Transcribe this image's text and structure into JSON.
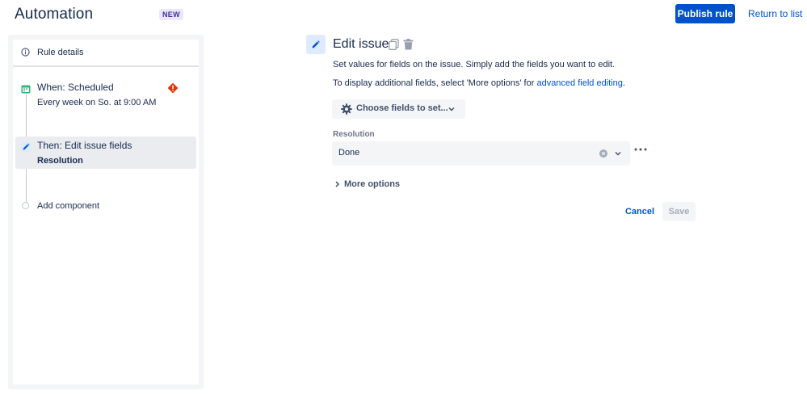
{
  "header": {
    "title": "Automation",
    "badge": "NEW",
    "publish_label": "Publish rule",
    "return_label": "Return to list"
  },
  "sidebar": {
    "rule_details_label": "Rule details",
    "trigger": {
      "title": "When: Scheduled",
      "subtitle": "Every week on So. at 9:00 AM",
      "icon": "calendar-icon",
      "has_error": true
    },
    "action": {
      "title": "Then: Edit issue fields",
      "subtitle": "Resolution",
      "icon": "pencil-icon",
      "selected": true
    },
    "add_component_label": "Add component"
  },
  "editor": {
    "title": "Edit issue",
    "description": "Set values for fields on the issue. Simply add the fields you want to edit.",
    "description2_prefix": "To display additional fields, select 'More options' for ",
    "description2_link": "advanced field editing",
    "description2_suffix": ".",
    "choose_fields_label": "Choose fields to set...",
    "field": {
      "label": "Resolution",
      "value": "Done"
    },
    "more_options_label": "More options",
    "cancel_label": "Cancel",
    "save_label": "Save"
  },
  "colors": {
    "primary": "#0052CC",
    "text": "#172B4D",
    "error": "#DE350B",
    "trigger_icon": "#36B37E",
    "selected_bg": "#EBECF0"
  }
}
